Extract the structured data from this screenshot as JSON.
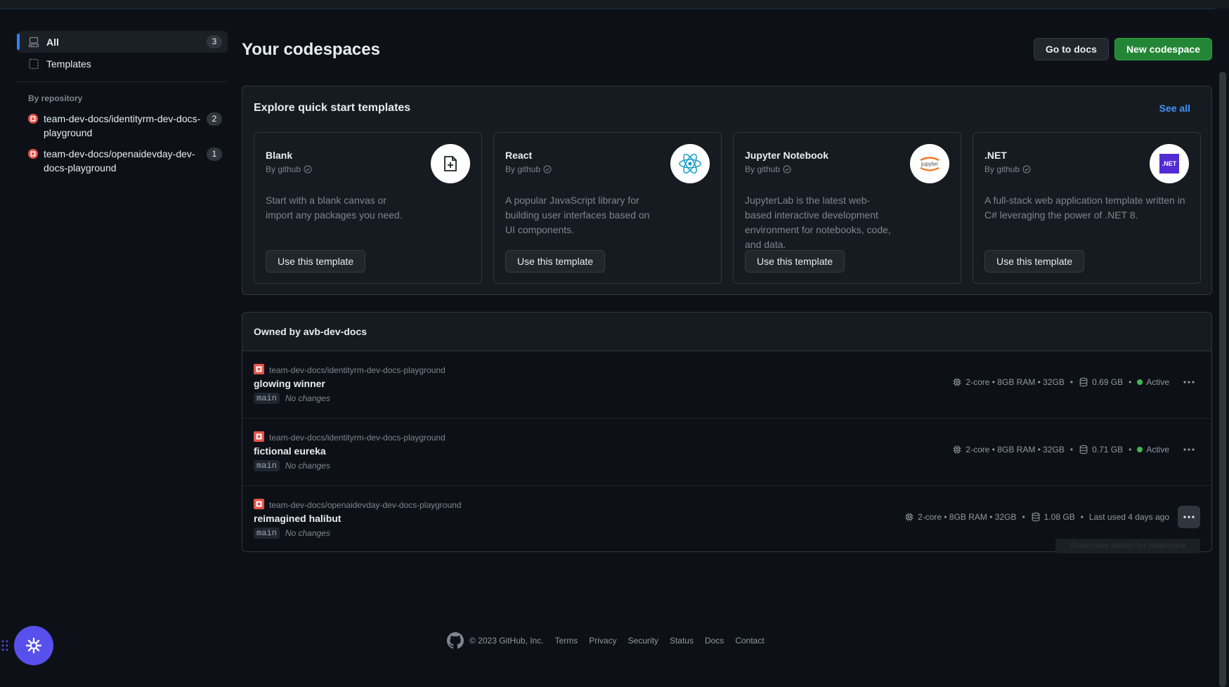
{
  "sidebar": {
    "items": [
      {
        "label": "All",
        "count": "3"
      },
      {
        "label": "Templates"
      }
    ],
    "by_repository_heading": "By repository",
    "repos": [
      {
        "label": "team-dev-docs/identityrm-dev-docs-playground",
        "count": "2"
      },
      {
        "label": "team-dev-docs/openaidevday-dev-docs-playground",
        "count": "1"
      }
    ]
  },
  "header": {
    "title": "Your codespaces",
    "docs_button": "Go to docs",
    "new_button": "New codespace"
  },
  "templates": {
    "title": "Explore quick start templates",
    "see_all": "See all",
    "cards": [
      {
        "name": "Blank",
        "by": "By github",
        "description": "Start with a blank canvas or import any packages you need.",
        "button": "Use this template",
        "icon": "file-plus-icon"
      },
      {
        "name": "React",
        "by": "By github",
        "description": "A popular JavaScript library for building user interfaces based on UI components.",
        "button": "Use this template",
        "icon": "react-logo-icon"
      },
      {
        "name": "Jupyter Notebook",
        "by": "By github",
        "description": "JupyterLab is the latest web-based interactive development environment for notebooks, code, and data.",
        "button": "Use this template",
        "icon": "jupyter-logo-icon",
        "logo_text": "jupyter"
      },
      {
        "name": ".NET",
        "by": "By github",
        "description": "A full-stack web application template written in C# leveraging the power of .NET 8.",
        "button": "Use this template",
        "icon": "dotnet-logo-icon",
        "logo_text": ".NET"
      }
    ]
  },
  "owned": {
    "title": "Owned by avb-dev-docs",
    "codespaces": [
      {
        "repo": "team-dev-docs/identityrm-dev-docs-playground",
        "name": "glowing winner",
        "branch": "main",
        "changes": "No changes",
        "machine": "2-core • 8GB RAM • 32GB",
        "storage": "0.69 GB",
        "status": "Active"
      },
      {
        "repo": "team-dev-docs/identityrm-dev-docs-playground",
        "name": "fictional eureka",
        "branch": "main",
        "changes": "No changes",
        "machine": "2-core • 8GB RAM • 32GB",
        "storage": "0.71 GB",
        "status": "Active"
      },
      {
        "repo": "team-dev-docs/openaidevday-dev-docs-playground",
        "name": "reimagined halibut",
        "branch": "main",
        "changes": "No changes",
        "machine": "2-core • 8GB RAM • 32GB",
        "storage": "1.08 GB",
        "status": "Last used 4 days ago",
        "tooltip": "Show more actions for codespace"
      }
    ],
    "separator": "•"
  },
  "footer": {
    "copyright": "© 2023 GitHub, Inc.",
    "links": [
      "Terms",
      "Privacy",
      "Security",
      "Status",
      "Docs",
      "Contact"
    ]
  },
  "colors": {
    "background": "#0d1117",
    "accent_blue": "#2f81f7",
    "primary_green": "#238636",
    "active_green": "#3fb950",
    "fab_purple": "#5850ec"
  }
}
